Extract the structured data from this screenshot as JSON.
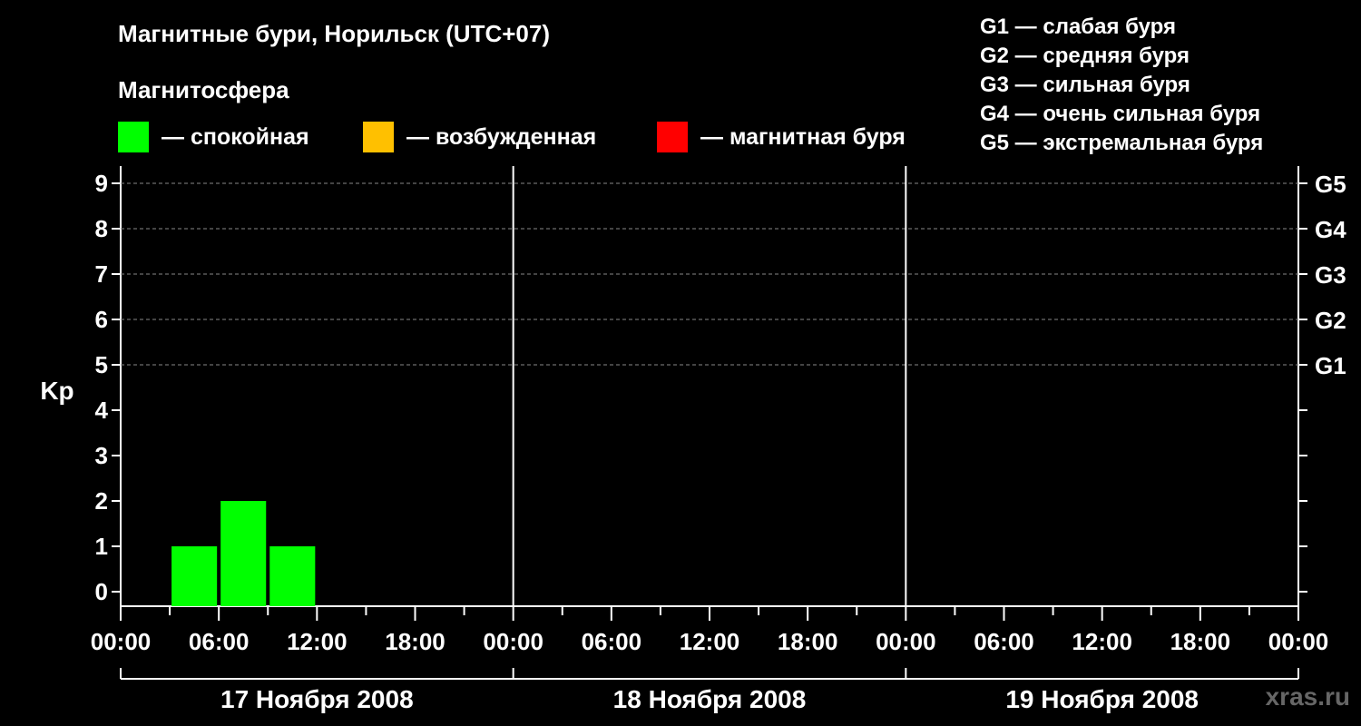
{
  "title": "Магнитные бури, Норильск (UTC+07)",
  "subtitle": "Магнитосфера",
  "legend": [
    {
      "label": "— спокойная",
      "color": "#00ff00"
    },
    {
      "label": "— возбужденная",
      "color": "#ffc000"
    },
    {
      "label": "— магнитная буря",
      "color": "#ff0000"
    }
  ],
  "g_scale": [
    "G1 — слабая буря",
    "G2 — средняя буря",
    "G3 — сильная буря",
    "G4 — очень сильная буря",
    "G5 — экстремальная буря"
  ],
  "watermark": "xras.ru",
  "chart_data": {
    "type": "bar",
    "ylabel": "Kp",
    "ylim": [
      0,
      9
    ],
    "yticks": [
      "0",
      "1",
      "2",
      "3",
      "4",
      "5",
      "6",
      "7",
      "8",
      "9"
    ],
    "right_ticks": [
      {
        "kp": 5,
        "label": "G1"
      },
      {
        "kp": 6,
        "label": "G2"
      },
      {
        "kp": 7,
        "label": "G3"
      },
      {
        "kp": 8,
        "label": "G4"
      },
      {
        "kp": 9,
        "label": "G5"
      }
    ],
    "grid": "dashed horizontal lines at Kp 5–9",
    "x_hours_range": [
      0,
      72
    ],
    "xtick_labels": [
      "00:00",
      "06:00",
      "12:00",
      "18:00",
      "00:00",
      "06:00",
      "12:00",
      "18:00",
      "00:00",
      "06:00",
      "12:00",
      "18:00",
      "00:00"
    ],
    "days": [
      "17 Ноября 2008",
      "18 Ноября 2008",
      "19 Ноября 2008"
    ],
    "bars": [
      {
        "start_hour": 3,
        "end_hour": 6,
        "kp": 1,
        "color": "#00ff00"
      },
      {
        "start_hour": 6,
        "end_hour": 9,
        "kp": 2,
        "color": "#00ff00"
      },
      {
        "start_hour": 9,
        "end_hour": 12,
        "kp": 1,
        "color": "#00ff00"
      }
    ]
  }
}
